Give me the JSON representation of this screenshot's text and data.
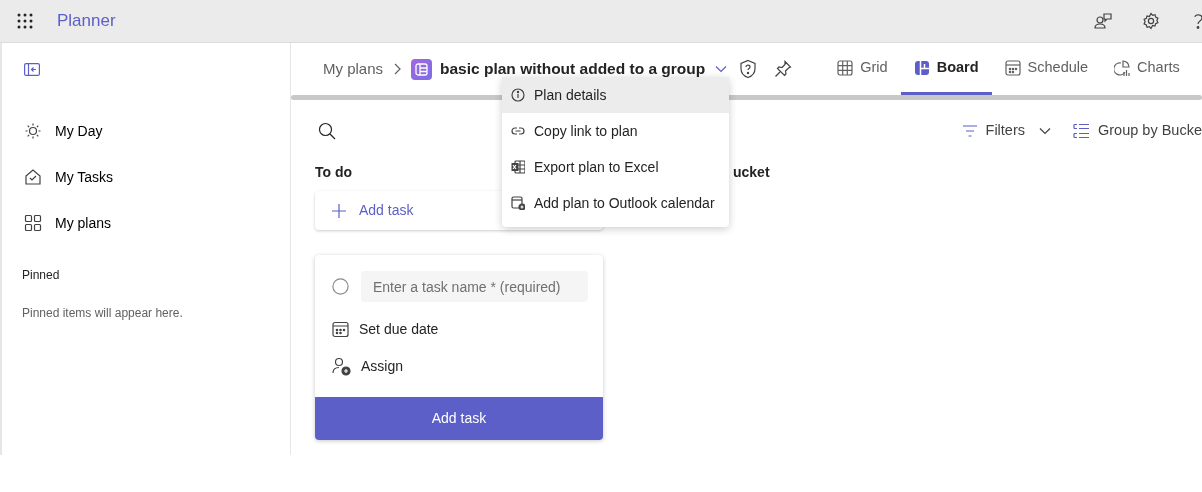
{
  "header": {
    "app_name": "Planner"
  },
  "sidebar": {
    "items": [
      {
        "label": "My Day"
      },
      {
        "label": "My Tasks"
      },
      {
        "label": "My plans"
      }
    ],
    "pinned_heading": "Pinned",
    "pinned_empty": "Pinned items will appear here."
  },
  "breadcrumb": {
    "parent": "My plans",
    "plan_title": "basic plan without added to a group"
  },
  "view_tabs": [
    {
      "label": "Grid",
      "selected": false
    },
    {
      "label": "Board",
      "selected": true
    },
    {
      "label": "Schedule",
      "selected": false
    },
    {
      "label": "Charts",
      "selected": false
    }
  ],
  "toolbar": {
    "filters": "Filters",
    "group_by": "Group by Bucke"
  },
  "buckets": [
    {
      "title": "To do",
      "add_task": "Add task"
    },
    {
      "title": "ucket"
    }
  ],
  "new_task_form": {
    "placeholder": "Enter a task name * (required)",
    "due_date": "Set due date",
    "assign": "Assign",
    "submit": "Add task"
  },
  "plan_menu": {
    "items": [
      {
        "label": "Plan details",
        "selected": true
      },
      {
        "label": "Copy link to plan",
        "selected": false
      },
      {
        "label": "Export plan to Excel",
        "selected": false
      },
      {
        "label": "Add plan to Outlook calendar",
        "selected": false
      }
    ]
  }
}
